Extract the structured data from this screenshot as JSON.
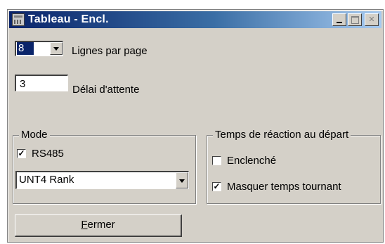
{
  "window": {
    "title": "Tableau - Encl.",
    "minimize_glyph": "",
    "maximize_glyph": "",
    "close_glyph": "✕",
    "icon": "table-app-icon"
  },
  "rows_per_page": {
    "value": "8",
    "label": "Lignes par page"
  },
  "timeout": {
    "value": "3",
    "label": "Délai d'attente"
  },
  "mode_group": {
    "title": "Mode",
    "rs485_label": "RS485",
    "rs485_checked": true,
    "device_select_value": "UNT4 Rank"
  },
  "reaction_group": {
    "title": "Temps de réaction au départ",
    "engaged_label": "Enclenché",
    "engaged_checked": false,
    "mask_label": "Masquer temps tournant",
    "mask_checked": true
  },
  "close_button": {
    "label_underlined": "F",
    "label_rest": "ermer"
  },
  "colors": {
    "face": "#d4d0c8",
    "title_start": "#0a246a",
    "title_end": "#a6caf0"
  }
}
